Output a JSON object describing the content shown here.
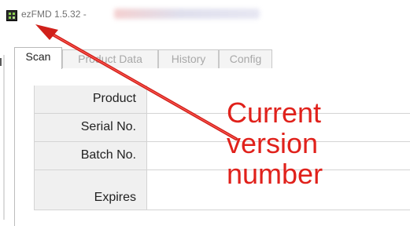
{
  "window": {
    "title_text": "ezFMD 1.5.32 -",
    "title_redacted": "HE (Username (hostname)/FMDHEC)"
  },
  "tabs": [
    {
      "label": "Scan",
      "active": true
    },
    {
      "label": "Product Data",
      "active": false
    },
    {
      "label": "History",
      "active": false
    },
    {
      "label": "Config",
      "active": false
    }
  ],
  "form": {
    "fields": [
      {
        "label": "Product",
        "value": ""
      },
      {
        "label": "Serial No.",
        "value": ""
      },
      {
        "label": "Batch No.",
        "value": ""
      },
      {
        "label": "Expires",
        "value": ""
      }
    ]
  },
  "annotation": {
    "text": "Current\nversion\nnumber",
    "color": "#e0211b"
  },
  "colors": {
    "annotation_red": "#e0211b",
    "label_background": "#f0f0f0",
    "inactive_tab_text": "#a8a8a8"
  }
}
